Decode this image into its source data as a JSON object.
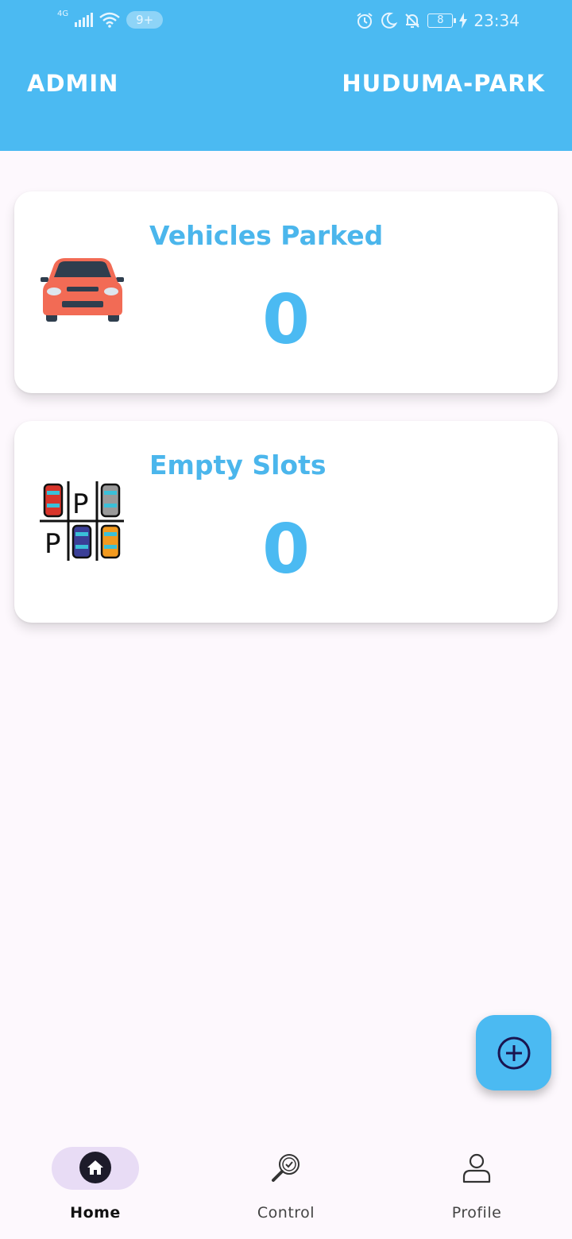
{
  "status_bar": {
    "network": "4G",
    "notification_count": "9+",
    "battery": "8",
    "time": "23:34"
  },
  "app_bar": {
    "left_title": "ADMIN",
    "right_title": "HUDUMA-PARK"
  },
  "cards": [
    {
      "label": "Vehicles Parked",
      "value": "0",
      "icon": "car-icon"
    },
    {
      "label": "Empty Slots",
      "value": "0",
      "icon": "parking-lot-icon"
    }
  ],
  "fab": {
    "icon": "add-circle-icon"
  },
  "bottom_nav": {
    "items": [
      {
        "label": "Home",
        "icon": "home-icon",
        "active": true
      },
      {
        "label": "Control",
        "icon": "search-check-icon",
        "active": false
      },
      {
        "label": "Profile",
        "icon": "person-icon",
        "active": false
      }
    ]
  },
  "colors": {
    "primary": "#4bbaf2",
    "background": "#fdf8fd",
    "nav_active_indicator": "#e8dcf5"
  }
}
